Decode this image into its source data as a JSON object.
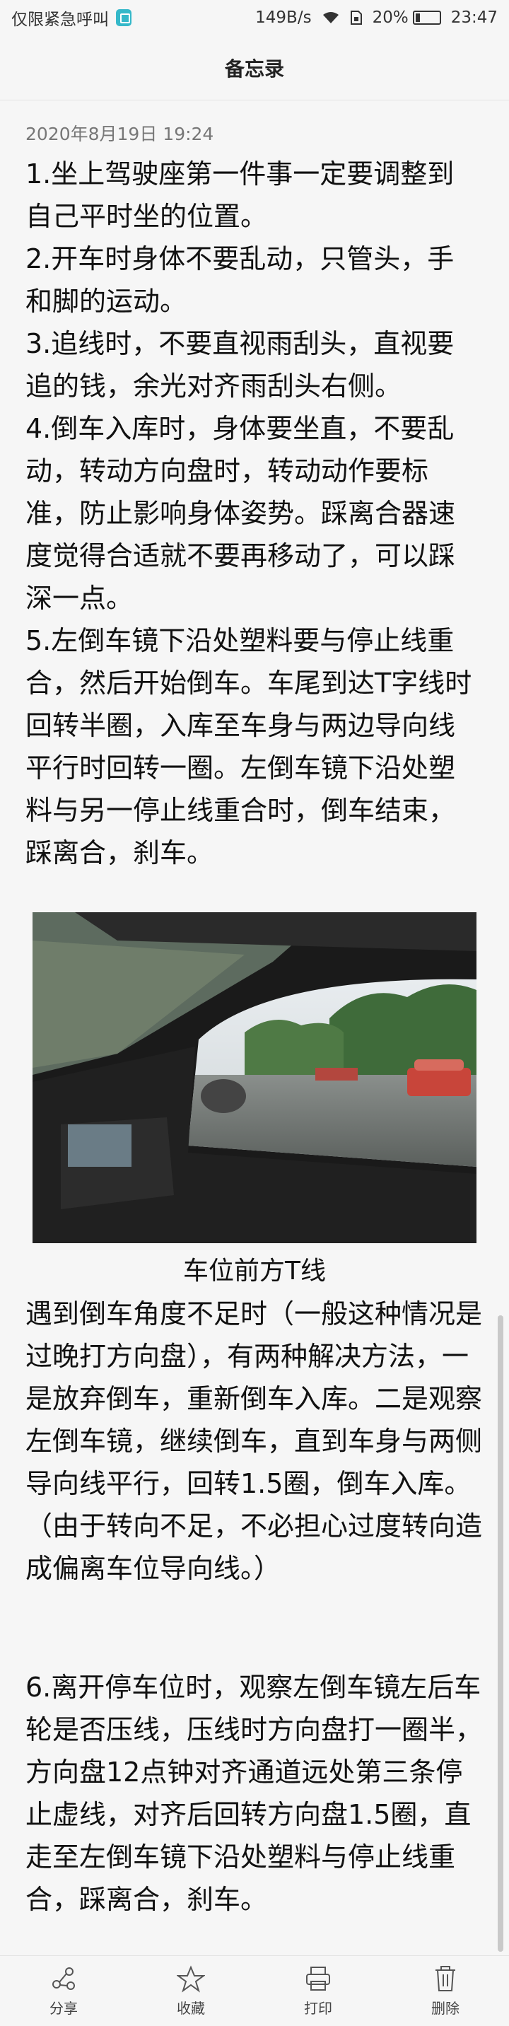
{
  "status_bar": {
    "carrier_text": "仅限紧急呼叫",
    "network_speed": "149B/s",
    "battery_percent": "20%",
    "battery_level": 0.2,
    "time": "23:47"
  },
  "header": {
    "title": "备忘录"
  },
  "note": {
    "timestamp": "2020年8月19日 19:24",
    "paragraphs": [
      "1.坐上驾驶座第一件事一定要调整到自己平时坐的位置。",
      "2.开车时身体不要乱动，只管头，手和脚的运动。",
      "3.追线时，不要直视雨刮头，直视要追的钱，余光对齐雨刮头右侧。",
      "4.倒车入库时，身体要坐直，不要乱动，转动方向盘时，转动动作要标准，防止影响身体姿势。踩离合器速度觉得合适就不要再移动了，可以踩深一点。",
      "5.左倒车镜下沿处塑料要与停止线重合，然后开始倒车。车尾到达T字线时回转半圈，入库至车身与两边导向线平行时回转一圈。左倒车镜下沿处塑料与另一停止线重合时，倒车结束，踩离合，刹车。"
    ],
    "photo_caption": "车位前方T线",
    "paragraph_after_photo": "  遇到倒车角度不足时（一般这种情况是过晚打方向盘），有两种解决方法，一是放弃倒车，重新倒车入库。二是观察左倒车镜，继续倒车，直到车身与两侧导向线平行，回转1.5圈，倒车入库。（由于转向不足，不必担心过度转向造成偏离车位导向线。）",
    "paragraph_6": "6.离开停车位时，观察左倒车镜左后车轮是否压线，压线时方向盘打一圈半，方向盘12点钟对齐通道远处第三条停止虚线，对齐后回转方向盘1.5圈，直走至左倒车镜下沿处塑料与停止线重合，踩离合，刹车。"
  },
  "toolbar": {
    "share_label": "分享",
    "favorite_label": "收藏",
    "print_label": "打印",
    "delete_label": "删除"
  },
  "icons": {
    "share": "share-icon",
    "favorite": "star-icon",
    "print": "printer-icon",
    "delete": "trash-icon"
  }
}
